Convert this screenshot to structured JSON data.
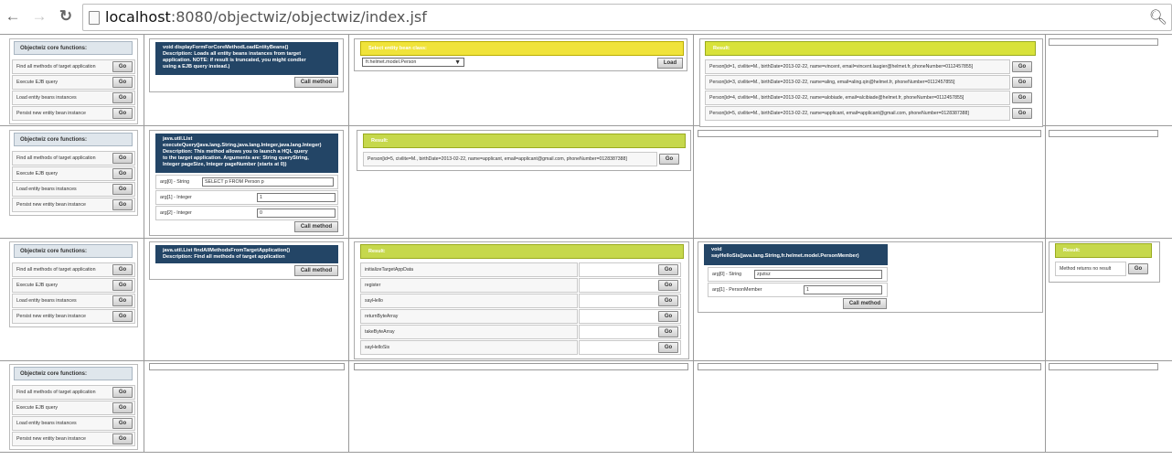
{
  "browser": {
    "url_host": "localhost",
    "url_rest": ":8080/objectwiz/objectwiz/index.jsf"
  },
  "core": {
    "title": "Objectwiz core functions:",
    "items": [
      "Find all methods of target application",
      "Execute EJB query",
      "Load entity beans instances",
      "Persist new entity bean instance"
    ],
    "go": "Go"
  },
  "call_label": "Call method",
  "row1": {
    "method": "void displayFormForCoreMethodLoadEntityBeans()\nDescription: Loads all entity beans instances from target\napplication. NOTE: if result is truncated, you might condier\nusing a EJB query instead.)",
    "entity_title": "Select entity bean class:",
    "entity_value": "fr.helmet.model.Person",
    "load": "Load",
    "result_title": "Result:",
    "results": [
      "Person[id=1, civilite=M., birthDate=2013-02-22, name=vincent, email=vincent.laugier@helmet.fr, phoneNumber=0112457855]",
      "Person[id=3, civilite=M., birthDate=2013-02-22, name=aling, email=aling.qin@helmet.fr, phoneNumber=0112457855]",
      "Person[id=4, civilite=M., birthDate=2013-02-22, name=alobiade, email=alcibiade@helmet.fr, phoneNumber=0112457855]",
      "Person[id=5, civilite=M., birthDate=2013-02-22, name=applicant, email=applicant@gmail.com, phoneNumber=0128387388]"
    ]
  },
  "row2": {
    "method": "java.util.List\nexecuteQuery(java.lang.String,java.lang.Integer,java.lang.Integer)\nDescription: This method allows you to launch a HQL query\nto the target application. Arguments are: String queryString,\nInteger pageSize, Integer pageNumber (starts at 0))",
    "args": [
      {
        "label": "arg[0] - String",
        "value": "SELECT p FROM Person p"
      },
      {
        "label": "arg[1] - Integer",
        "value": "1"
      },
      {
        "label": "arg[2] - Integer",
        "value": "0"
      }
    ],
    "result_title": "Result:",
    "result": "Person[id=5, civilite=M., birthDate=2013-02-22, name=applicant, email=applicant@gmail.com, phoneNumber=0128387388]"
  },
  "row3": {
    "method": "java.util.List findAllMethodsFromTargetApplication()\nDescription: Find all methods of target application",
    "result_title": "Result:",
    "methods": [
      "initializeTargetAppData",
      "register",
      "sayHello",
      "returnByteArray",
      "takeByteArray",
      "sayHelloSis"
    ],
    "method2": "void\nsayHelloSis(java.lang.String,fr.helmet.model.PersonMember)",
    "args2": [
      {
        "label": "arg[0] - String",
        "value": "zpzisz"
      },
      {
        "label": "arg[1] - PersonMember",
        "value": "1"
      }
    ],
    "result2_title": "Result:",
    "result2": "Method returns no result"
  }
}
